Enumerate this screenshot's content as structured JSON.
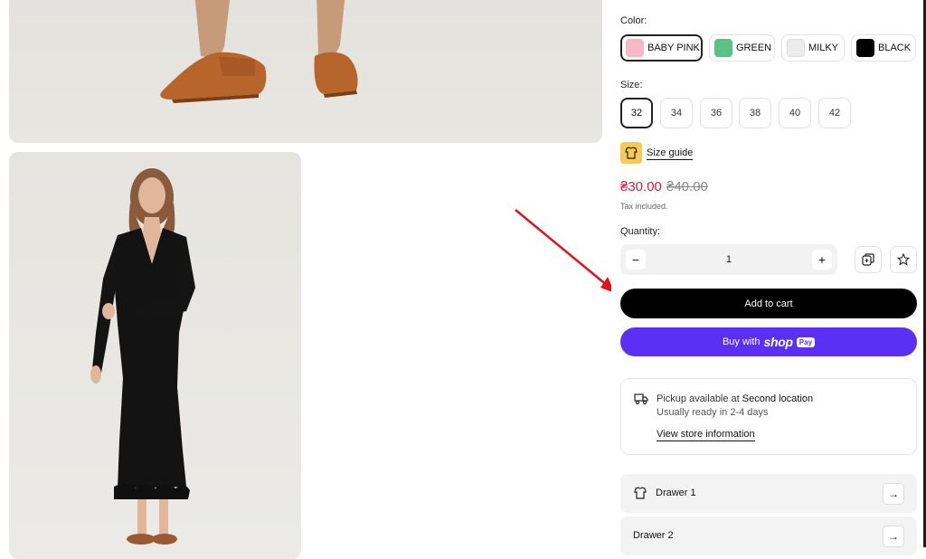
{
  "color": {
    "label": "Color:",
    "options": [
      {
        "name": "BABY PINK",
        "hex": "#f9b8c8",
        "selected": true
      },
      {
        "name": "GREEN",
        "hex": "#5ac287",
        "selected": false
      },
      {
        "name": "MILKY",
        "hex": "#ececec",
        "selected": false
      },
      {
        "name": "BLACK",
        "hex": "#000000",
        "selected": false
      }
    ]
  },
  "size": {
    "label": "Size:",
    "options": [
      "32",
      "34",
      "36",
      "38",
      "40",
      "42"
    ],
    "selected": "32",
    "guide_label": "Size guide"
  },
  "price": {
    "current": "₴30.00",
    "compare_at": "₴40.00",
    "tax_note": "Tax included."
  },
  "quantity": {
    "label": "Quantity:",
    "value": "1"
  },
  "buttons": {
    "add_to_cart": "Add to cart",
    "buy_with": "Buy with",
    "shop_brand": "shop",
    "shop_pay_badge": "Pay"
  },
  "pickup": {
    "available_prefix": "Pickup available at",
    "location": "Second location",
    "ready": "Usually ready in 2-4 days",
    "store_info": "View store information"
  },
  "drawers": [
    {
      "label": "Drawer 1",
      "icon": "shirt-icon"
    },
    {
      "label": "Drawer 2",
      "icon": null
    }
  ],
  "colors": {
    "price_sale": "#d61f3a",
    "shop_pay": "#5a31f4",
    "size_guide_icon_bg": "#f7c85a",
    "annotation_arrow": "#e3131b"
  }
}
